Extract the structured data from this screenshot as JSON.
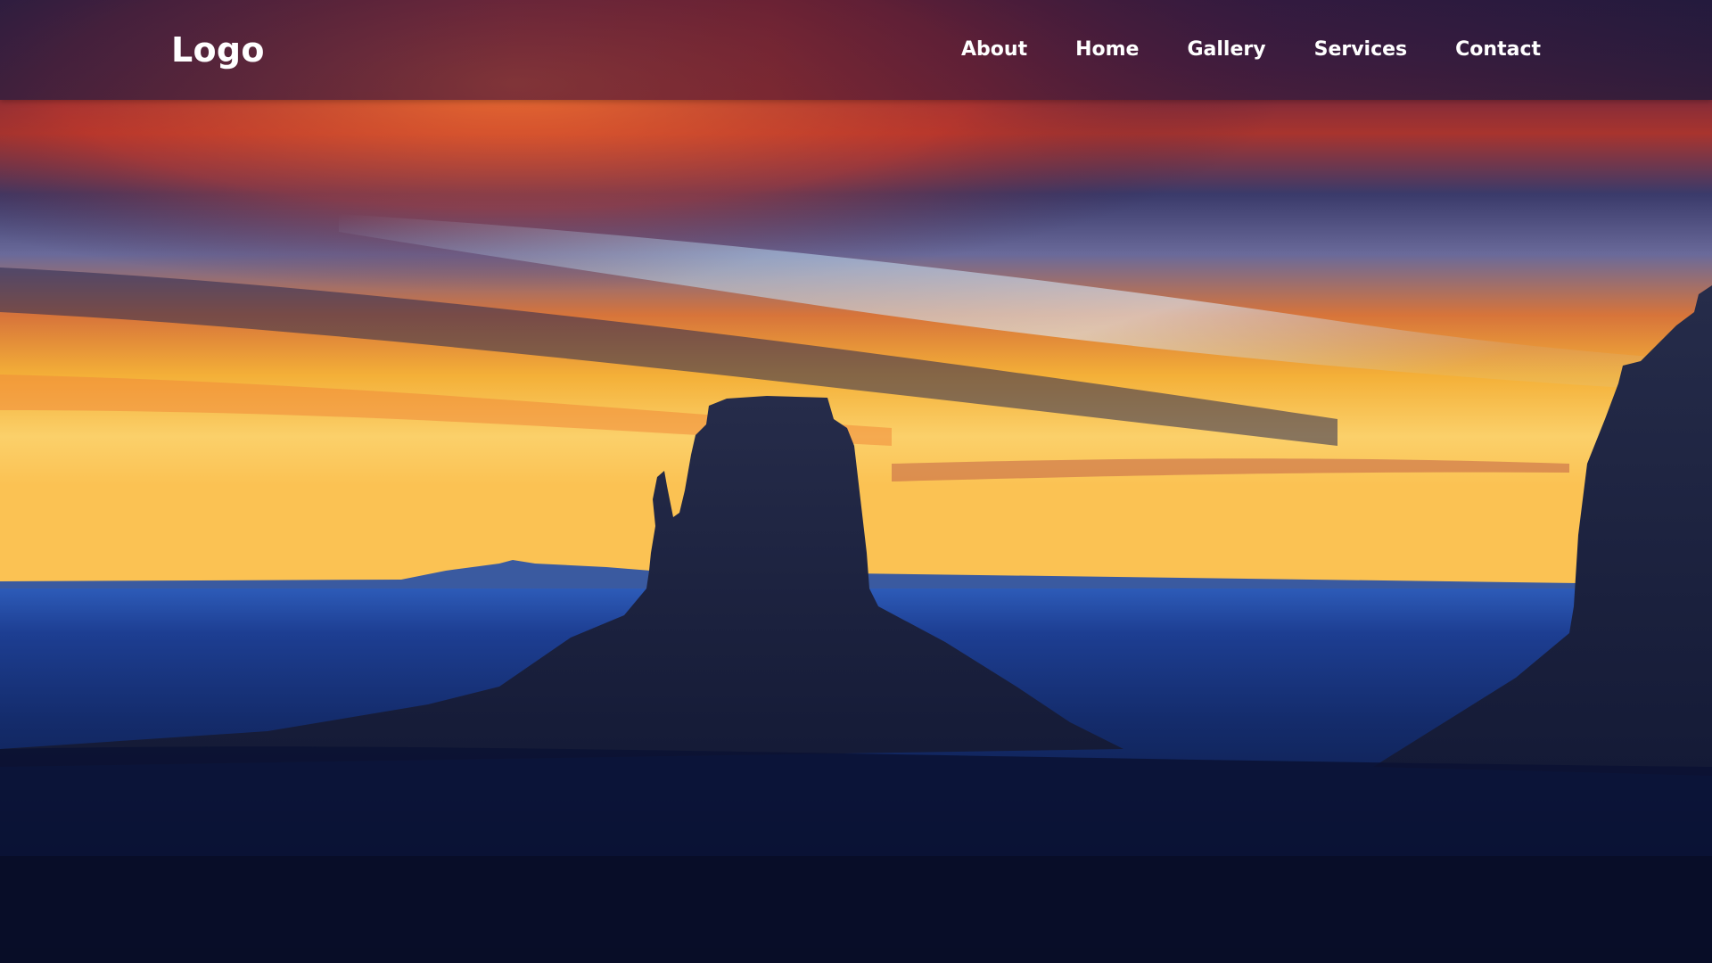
{
  "header": {
    "logo_text": "Logo",
    "nav_items": [
      {
        "label": "About"
      },
      {
        "label": "Home"
      },
      {
        "label": "Gallery"
      },
      {
        "label": "Services"
      },
      {
        "label": "Contact"
      }
    ]
  },
  "hero": {
    "image_subject": "desert mesa silhouette at sunrise",
    "colors": {
      "sky_top": "#2a1a4a",
      "sky_orange": "#e8642c",
      "sky_horizon": "#f7b23a",
      "cloud_light": "#9fc7e8",
      "ground_blue": "#1a3a8a",
      "ground_dark": "#0a1030",
      "rock": "#1c2342"
    }
  }
}
